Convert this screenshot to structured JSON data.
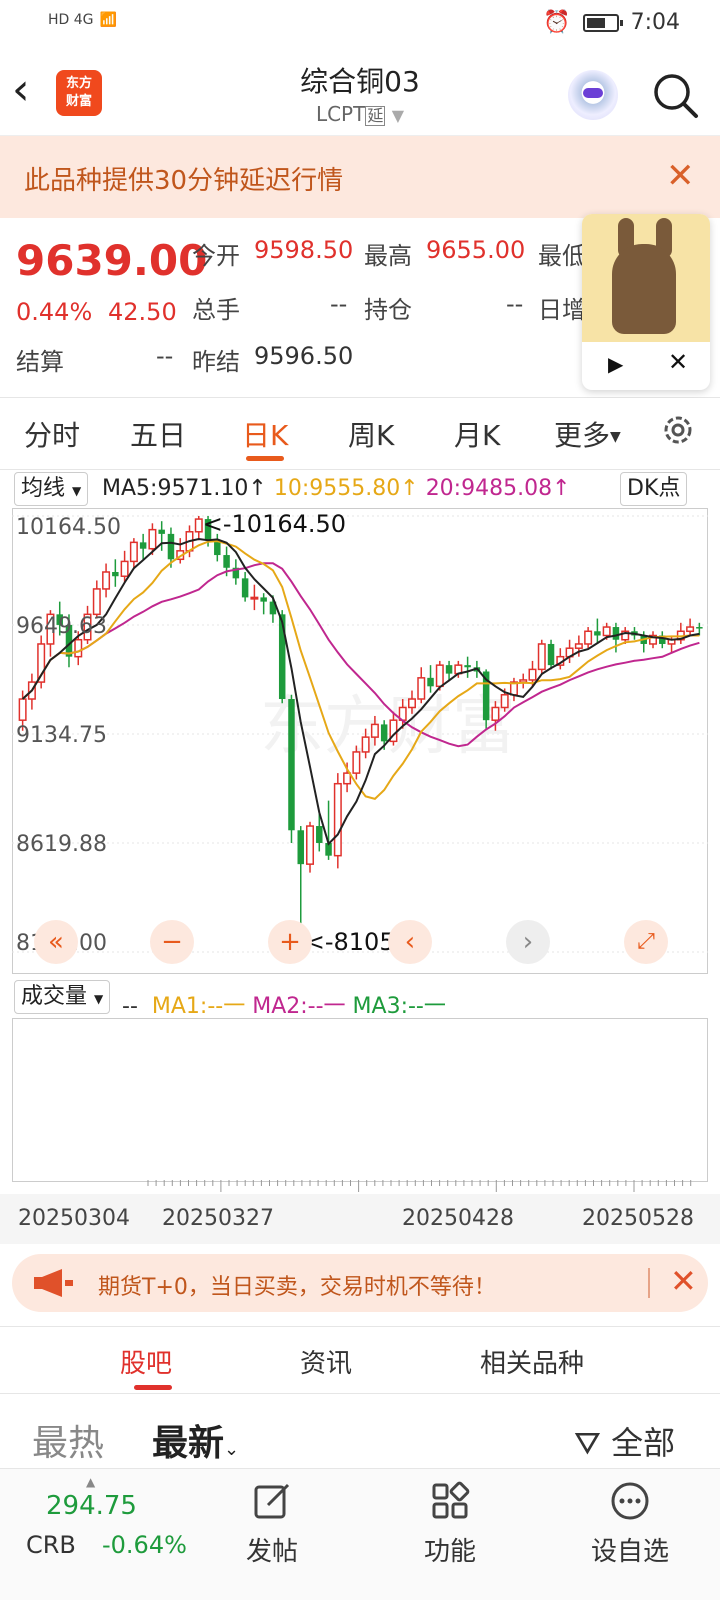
{
  "status": {
    "signal": "HD 4G",
    "time": "7:04"
  },
  "header": {
    "title": "综合铜03",
    "code": "LCPT",
    "code_tag": "延",
    "logo_line1": "东方",
    "logo_line2": "财富"
  },
  "notice": {
    "text": "此品种提供30分钟延迟行情"
  },
  "quote": {
    "price": "9639.00",
    "change_pct": "0.44%",
    "change": "42.50",
    "open_label": "今开",
    "open": "9598.50",
    "high_label": "最高",
    "high": "9655.00",
    "low_label_partial": "最低",
    "volume_label": "总手",
    "volume": "--",
    "position_label": "持仓",
    "position": "--",
    "daily_label_partial": "日增",
    "settle_label": "结算",
    "settle": "--",
    "prev_settle_label": "昨结",
    "prev_settle": "9596.50"
  },
  "tabs": [
    "分时",
    "五日",
    "日K",
    "周K",
    "月K",
    "更多"
  ],
  "active_tab": "日K",
  "ma_bar": {
    "selector": "均线",
    "ma5": "MA5:9571.10↑",
    "ma10": "10:9555.80↑",
    "ma20": "20:9485.08↑",
    "dk": "DK点"
  },
  "axis": {
    "y_ticks": [
      "10164.50",
      "9649.63",
      "9134.75",
      "8619.88",
      "8105.00"
    ],
    "max_label": "<-10164.50",
    "min_label": "<-8105.00"
  },
  "volume_bar": {
    "selector": "成交量",
    "dash": "--",
    "ma1": "MA1:--一",
    "ma2": "MA2:--一",
    "ma3": "MA3:--一"
  },
  "dates": [
    "20250304",
    "20250327",
    "20250428",
    "20250528"
  ],
  "promo": {
    "text": "期货T+0，当日买卖，交易时机不等待！"
  },
  "forum_tabs": [
    "股吧",
    "资讯",
    "相关品种"
  ],
  "sort": {
    "hot": "最热",
    "new": "最新",
    "filter": "全部"
  },
  "bottom": {
    "crb_value": "294.75",
    "crb_name": "CRB",
    "crb_pct": "-0.64%",
    "post": "发帖",
    "func": "功能",
    "fav": "设自选"
  },
  "colors": {
    "up": "#e0312c",
    "down": "#1e9b3c",
    "accent": "#e85a1c",
    "ma5": "#222222",
    "ma10": "#e6a817",
    "ma20": "#c0278f"
  },
  "chart_data": {
    "type": "candlestick",
    "ylim": [
      8105.0,
      10164.5
    ],
    "candles": [
      [
        9200,
        9300,
        9150,
        9340
      ],
      [
        9300,
        9380,
        9250,
        9420
      ],
      [
        9380,
        9560,
        9350,
        9600
      ],
      [
        9560,
        9700,
        9500,
        9720
      ],
      [
        9700,
        9650,
        9600,
        9760
      ],
      [
        9650,
        9500,
        9450,
        9700
      ],
      [
        9500,
        9580,
        9460,
        9620
      ],
      [
        9580,
        9700,
        9560,
        9740
      ],
      [
        9700,
        9820,
        9680,
        9860
      ],
      [
        9820,
        9900,
        9780,
        9940
      ],
      [
        9900,
        9880,
        9830,
        9960
      ],
      [
        9880,
        9950,
        9850,
        10000
      ],
      [
        9950,
        10040,
        9920,
        10060
      ],
      [
        10040,
        10010,
        9960,
        10080
      ],
      [
        10010,
        10100,
        9980,
        10130
      ],
      [
        10100,
        10080,
        10000,
        10140
      ],
      [
        10080,
        9960,
        9920,
        10110
      ],
      [
        9960,
        10000,
        9940,
        10060
      ],
      [
        10000,
        10090,
        9970,
        10120
      ],
      [
        10090,
        10150,
        10050,
        10164.5
      ],
      [
        10150,
        10050,
        10020,
        10164.5
      ],
      [
        10050,
        9980,
        9950,
        10080
      ],
      [
        9980,
        9920,
        9880,
        10020
      ],
      [
        9920,
        9870,
        9840,
        9960
      ],
      [
        9870,
        9780,
        9760,
        9900
      ],
      [
        9780,
        9780,
        9720,
        9840
      ],
      [
        9780,
        9760,
        9700,
        9800
      ],
      [
        9760,
        9700,
        9660,
        9790
      ],
      [
        9700,
        9300,
        9280,
        9720
      ],
      [
        9300,
        8680,
        8620,
        9320
      ],
      [
        8680,
        8520,
        8105,
        8700
      ],
      [
        8520,
        8700,
        8480,
        8720
      ],
      [
        8700,
        8620,
        8580,
        8760
      ],
      [
        8620,
        8560,
        8540,
        8820
      ],
      [
        8560,
        8900,
        8500,
        8950
      ],
      [
        8900,
        8950,
        8860,
        9000
      ],
      [
        8950,
        9050,
        8920,
        9080
      ],
      [
        9050,
        9120,
        9020,
        9160
      ],
      [
        9120,
        9180,
        9080,
        9220
      ],
      [
        9180,
        9100,
        9060,
        9200
      ],
      [
        9100,
        9200,
        9080,
        9240
      ],
      [
        9200,
        9260,
        9160,
        9300
      ],
      [
        9260,
        9300,
        9230,
        9340
      ],
      [
        9300,
        9400,
        9280,
        9450
      ],
      [
        9400,
        9360,
        9330,
        9460
      ],
      [
        9360,
        9460,
        9340,
        9480
      ],
      [
        9460,
        9420,
        9390,
        9480
      ],
      [
        9420,
        9460,
        9400,
        9480
      ],
      [
        9460,
        9450,
        9400,
        9500
      ],
      [
        9450,
        9430,
        9400,
        9480
      ],
      [
        9430,
        9200,
        9160,
        9440
      ],
      [
        9200,
        9260,
        9150,
        9290
      ],
      [
        9260,
        9320,
        9240,
        9350
      ],
      [
        9320,
        9380,
        9290,
        9400
      ],
      [
        9380,
        9390,
        9350,
        9420
      ],
      [
        9390,
        9440,
        9360,
        9480
      ],
      [
        9440,
        9560,
        9420,
        9580
      ],
      [
        9560,
        9460,
        9440,
        9580
      ],
      [
        9460,
        9500,
        9440,
        9540
      ],
      [
        9500,
        9540,
        9470,
        9580
      ],
      [
        9540,
        9560,
        9500,
        9600
      ],
      [
        9560,
        9620,
        9540,
        9640
      ],
      [
        9620,
        9600,
        9560,
        9680
      ],
      [
        9600,
        9640,
        9580,
        9660
      ],
      [
        9640,
        9580,
        9520,
        9660
      ],
      [
        9580,
        9620,
        9560,
        9640
      ],
      [
        9620,
        9600,
        9580,
        9640
      ],
      [
        9600,
        9560,
        9520,
        9620
      ],
      [
        9560,
        9600,
        9540,
        9620
      ],
      [
        9600,
        9560,
        9540,
        9620
      ],
      [
        9560,
        9580,
        9520,
        9600
      ],
      [
        9580,
        9620,
        9560,
        9660
      ],
      [
        9620,
        9640,
        9600,
        9680
      ],
      [
        9640,
        9639,
        9600,
        9660
      ]
    ]
  }
}
